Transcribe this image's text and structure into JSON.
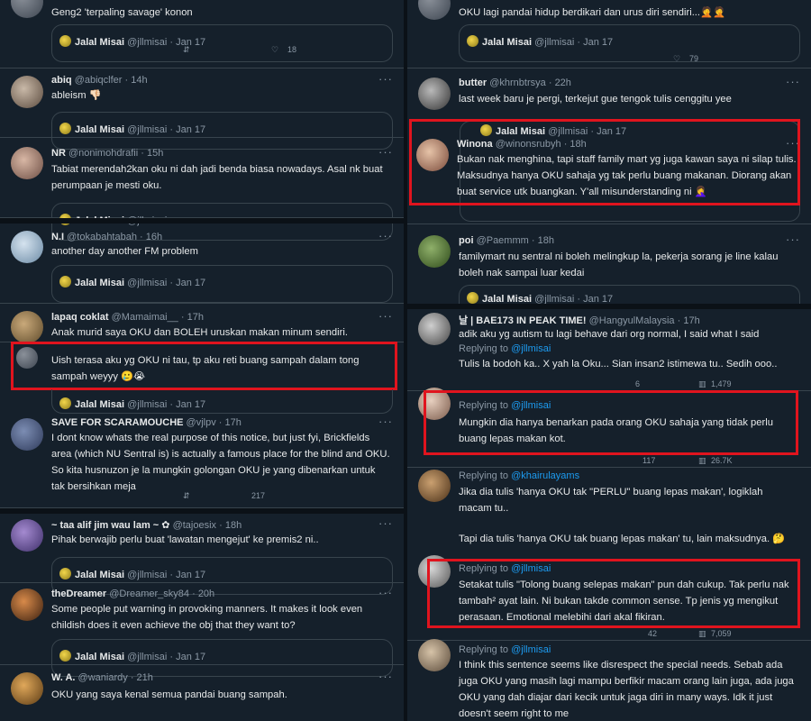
{
  "quoted": {
    "name": "Jalal Misai",
    "handle": "@jllmisai",
    "date": "Jan 17"
  },
  "left": [
    {
      "name": "",
      "handle": "",
      "time": "",
      "text": "Geng2 'terpaling savage' konon",
      "metric": "18"
    },
    {
      "name": "abiq",
      "handle": "@abiqclfer",
      "time": "14h",
      "text": "ableism 👎🏻"
    },
    {
      "name": "NR",
      "handle": "@nonimohdrafii",
      "time": "15h",
      "text": "Tabiat merendah2kan oku ni dah jadi benda biasa nowadays. Asal nk buat perumpaan je mesti oku."
    },
    {
      "name": "N.I",
      "handle": "@tokabahtabah",
      "time": "16h",
      "text": "another day another FM problem"
    },
    {
      "name": "lapaq coklat",
      "handle": "@Mamaimai__",
      "time": "17h",
      "text": "Anak murid saya OKU dan BOLEH uruskan makan minum sendiri."
    },
    {
      "name": "",
      "handle": "",
      "time": "",
      "text": "Uish terasa aku yg OKU ni tau, tp aku reti buang sampah dalam tong sampah weyyy 🥲😭"
    },
    {
      "name": "SAVE FOR SCARAMOUCHE",
      "handle": "@vjlpv",
      "time": "17h",
      "text": "I dont know whats the real purpose of this notice, but just fyi, Brickfields area (which NU Sentral is) is actually a famous place for the blind and OKU. So kita husnuzon je la mungkin golongan OKU je yang dibenarkan untuk tak bersihkan meja",
      "metric": "217"
    },
    {
      "name": "~ taa alif jim wau lam ~ ✿",
      "handle": "@tajoesix",
      "time": "18h",
      "text": "Pihak berwajib perlu buat 'lawatan mengejut' ke premis2 ni.."
    },
    {
      "name": "theDreamer",
      "handle": "@Dreamer_sky84",
      "time": "20h",
      "text": "Some people put warning in provoking manners. It makes it look even childish does it even achieve the obj that they want to?"
    },
    {
      "name": "W. A.",
      "handle": "@waniardy",
      "time": "21h",
      "text": "OKU yang saya kenal semua pandai buang sampah."
    }
  ],
  "right": [
    {
      "text": "OKU lagi pandai hidup berdikari dan urus diri sendiri...🤦🤦",
      "metric": "79"
    },
    {
      "name": "butter",
      "handle": "@khrnbtrsya",
      "time": "22h",
      "text": "last week baru je pergi, terkejut gue tengok tulis cenggitu yee"
    },
    {
      "name": "Winona",
      "handle": "@winonsrubyh",
      "time": "18h",
      "text": "Bukan nak menghina, tapi staff family mart yg juga kawan saya ni silap tulis. Maksudnya hanya OKU sahaja yg tak perlu buang makanan. Diorang akan buat service utk buangkan. Y'all misunderstanding ni 🤦‍♀️"
    },
    {
      "name": "poi",
      "handle": "@Paemmm",
      "time": "18h",
      "text": "familymart nu sentral ni boleh melingkup la, pekerja sorang je line kalau boleh nak sampai luar kedai"
    },
    {
      "name": "날 | BAE173 IN PEAK TIME!",
      "handle": "@HangyulMalaysia",
      "time": "17h",
      "text": "adik aku yg autism tu lagi behave dari org normal, I said what I said"
    },
    {
      "reply_label": "Replying to",
      "reply_handle": "@jllmisai",
      "text": "Tulis la bodoh ka.. X yah la Oku... Sian insan2 istimewa tu.. Sedih ooo..",
      "stats": [
        "6",
        "1,479"
      ]
    },
    {
      "reply_label": "Replying to",
      "reply_handle": "@jllmisai",
      "text": "Mungkin dia hanya benarkan pada orang OKU sahaja yang tidak perlu buang lepas makan kot.",
      "stats": [
        "117",
        "26.7K"
      ]
    },
    {
      "reply_label": "Replying to",
      "reply_handle": "@khairulayams",
      "text": "Jika dia tulis 'hanya OKU tak \"PERLU\" buang lepas makan', logiklah macam tu..",
      "text2": "Tapi dia tulis 'hanya OKU tak buang lepas makan' tu, lain maksudnya. 🤔"
    },
    {
      "reply_label": "Replying to",
      "reply_handle": "@jllmisai",
      "text": "Setakat tulis \"Tolong buang selepas makan\" pun dah cukup. Tak perlu nak tambah² ayat lain. Ni bukan takde common sense. Tp jenis yg mengikut perasaan. Emotional melebihi dari akal fikiran.",
      "stats": [
        "42",
        "7,059"
      ]
    },
    {
      "reply_label": "Replying to",
      "reply_handle": "@jllmisai",
      "text": "I think this sentence seems like disrespect the special needs. Sebab ada juga OKU yang masih lagi mampu berfikir macam orang lain juga, ada juga OKU yang dah diajar dari kecik untuk jaga diri in many ways. Idk it just doesn't seem right to me"
    }
  ],
  "icons": [
    "reply-icon",
    "retweet-icon",
    "like-icon",
    "views-icon",
    "share-icon",
    "more-icon"
  ],
  "colors": {
    "background": "#15202b",
    "text": "#e7e9ea",
    "muted": "#8b98a5",
    "link": "#1d9bf0",
    "highlight": "#e0141e"
  }
}
